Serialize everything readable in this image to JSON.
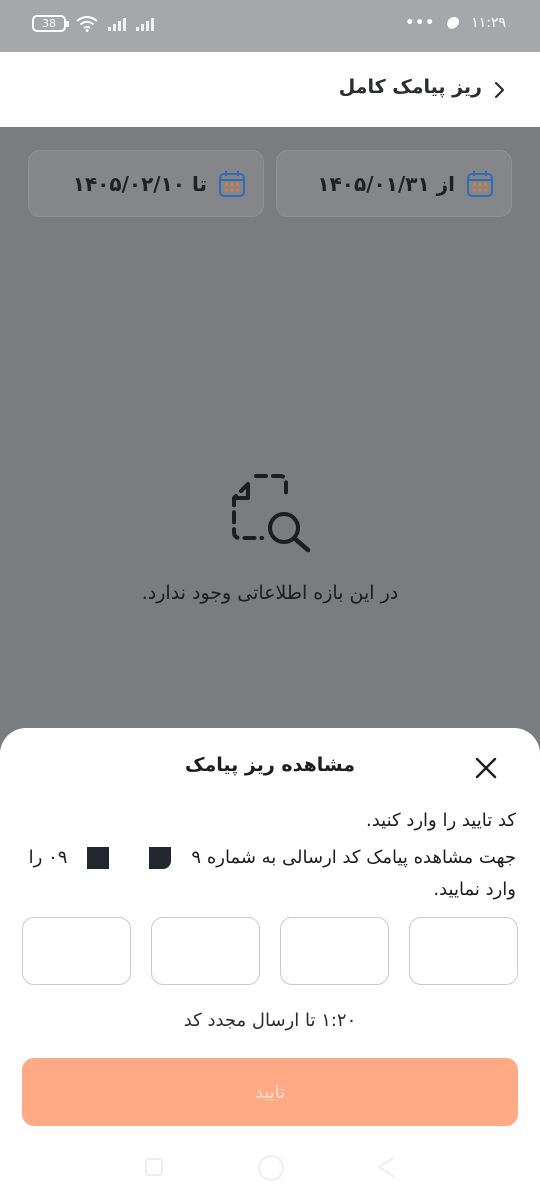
{
  "status_bar": {
    "battery": "38",
    "time": "۱۱:۲۹",
    "dots": "•••"
  },
  "header": {
    "title": "ریز پیامک کامل"
  },
  "date_filter": {
    "from_label": "از",
    "from_date": "۱۴۰۵/۰۱/۳۱",
    "to_label": "تا",
    "to_date": "۱۴۰۵/۰۲/۱۰"
  },
  "empty_state": {
    "message": "در این بازه اطلاعاتی وجود ندارد."
  },
  "sheet": {
    "title": "مشاهده ریز پیامک",
    "instruction_line1": "کد تایید را وارد کنید.",
    "instruction_prefix": "جهت مشاهده پیامک کد ارسالی به شماره ۹",
    "number_tail": "۰۹",
    "instruction_suffix": "را وارد نمایید.",
    "otp_count": 4,
    "resend_text": "۱:۲۰ تا ارسال مجدد کد",
    "confirm_label": "تایید"
  },
  "colors": {
    "accent_button": "#ffa985",
    "overlay": "#7b7c7f",
    "calendar_icon": "#2f6db5"
  }
}
